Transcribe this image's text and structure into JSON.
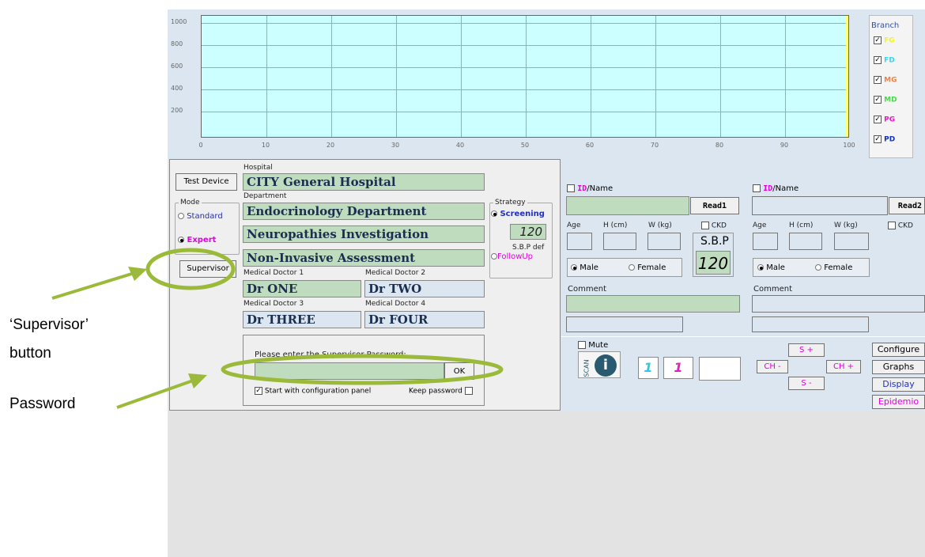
{
  "chart": {
    "y_ticks": [
      "1000",
      "800",
      "600",
      "400",
      "200"
    ],
    "x_ticks": [
      "0",
      "10",
      "20",
      "30",
      "40",
      "50",
      "60",
      "70",
      "80",
      "90",
      "100"
    ],
    "branch_title": "Branch",
    "branches": [
      {
        "label": "FG",
        "color": "#f0f040"
      },
      {
        "label": "FD",
        "color": "#30d8f0"
      },
      {
        "label": "MG",
        "color": "#f08040"
      },
      {
        "label": "MD",
        "color": "#40e040"
      },
      {
        "label": "PG",
        "color": "#e020c0"
      },
      {
        "label": "PD",
        "color": "#1030c0"
      }
    ]
  },
  "left": {
    "test_device": "Test Device",
    "hospital_label": "Hospital",
    "hospital": "CITY General Hospital",
    "department_label": "Department",
    "department": "Endocrinology Department",
    "investigation": "Neuropathies Investigation",
    "assessment": "Non-Invasive Assessment",
    "mode_label": "Mode",
    "mode_standard": "Standard",
    "mode_expert": "Expert",
    "supervisor": "Supervisor",
    "strategy_label": "Strategy",
    "strategy_screening": "Screening",
    "strategy_value": "120",
    "sbp_def": "S.B.P def",
    "strategy_followup": "FollowUp",
    "doc1_label": "Medical Doctor 1",
    "doc1": "Dr ONE",
    "doc2_label": "Medical Doctor 2",
    "doc2": "Dr TWO",
    "doc3_label": "Medical Doctor 3",
    "doc3": "Dr THREE",
    "doc4_label": "Medical Doctor 4",
    "doc4": "Dr FOUR",
    "password_prompt": "Please enter the Supervisor Password:",
    "ok": "OK",
    "start_config": "Start with configuration panel",
    "keep_password": "Keep password"
  },
  "right": {
    "id_prefix": "ID",
    "name_suffix": "/Name",
    "read1": "Read1",
    "read2": "Read2",
    "age": "Age",
    "height": "H (cm)",
    "weight": "W (kg)",
    "ckd": "CKD",
    "sbp": "S.B.P",
    "sbp_value": "120",
    "male": "Male",
    "female": "Female",
    "comment": "Comment",
    "mute": "Mute",
    "scan": "SCAN",
    "num1": "1",
    "num2": "1",
    "s_plus": "S +",
    "s_minus": "S -",
    "ch_minus": "CH -",
    "ch_plus": "CH +",
    "configure": "Configure",
    "graphs": "Graphs",
    "display": "Display",
    "epidemio": "Epidemio"
  },
  "annotations": {
    "supervisor_line1": "‘Supervisor’",
    "supervisor_line2": "button",
    "password": "Password"
  },
  "colors": {
    "annotation": "#9cba3a",
    "field_green": "#bfdcbf",
    "panel_blue": "#dce6f0",
    "expert_magenta": "#e000e0",
    "link_blue": "#2030c0"
  }
}
